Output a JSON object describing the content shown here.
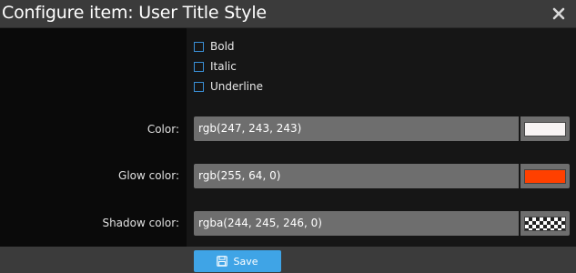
{
  "dialog": {
    "title": "Configure item: User Title Style"
  },
  "style_options": [
    {
      "label": "Bold",
      "checked": false
    },
    {
      "label": "Italic",
      "checked": false
    },
    {
      "label": "Underline",
      "checked": false
    }
  ],
  "color": {
    "label": "Color:",
    "value": "rgb(247, 243, 243)",
    "swatch": "#f7f3f3"
  },
  "glow_color": {
    "label": "Glow color:",
    "value": "rgb(255, 64, 0)",
    "swatch": "#ff4000"
  },
  "shadow_color": {
    "label": "Shadow color:",
    "value": "rgba(244, 245, 246, 0)",
    "swatch": "transparent"
  },
  "footer": {
    "save_label": "Save",
    "save_color": "#3fa4e6"
  }
}
